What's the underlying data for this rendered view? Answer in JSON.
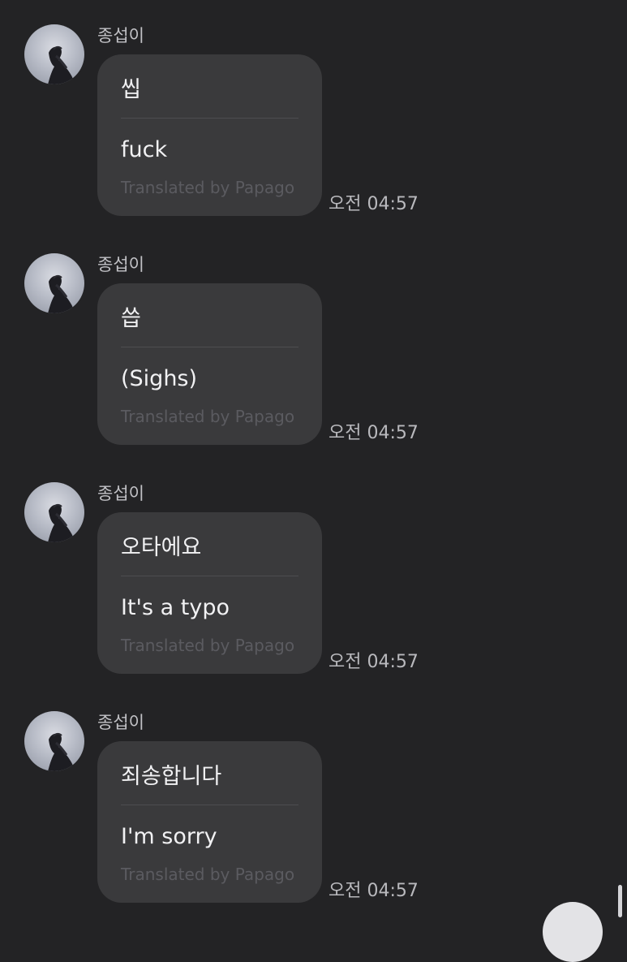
{
  "messages": [
    {
      "sender": "종섭이",
      "original": "씹",
      "translation": "fuck",
      "credit": "Translated by Papago",
      "time": "오전 04:57"
    },
    {
      "sender": "종섭이",
      "original": "씁",
      "translation": "(Sighs)",
      "credit": "Translated by Papago",
      "time": "오전 04:57"
    },
    {
      "sender": "종섭이",
      "original": "오타에요",
      "translation": "It's a typo",
      "credit": "Translated by Papago",
      "time": "오전 04:57"
    },
    {
      "sender": "종섭이",
      "original": "죄송합니다",
      "translation": "I'm sorry",
      "credit": "Translated by Papago",
      "time": "오전 04:57"
    }
  ],
  "colors": {
    "background": "#232325",
    "bubble": "#3a3a3c",
    "text": "#f1f1f3",
    "muted": "#5b5b60",
    "meta": "#b9b9bd"
  },
  "icons": {
    "avatar": "profile-photo",
    "scroll_button": "scroll-down-button"
  }
}
